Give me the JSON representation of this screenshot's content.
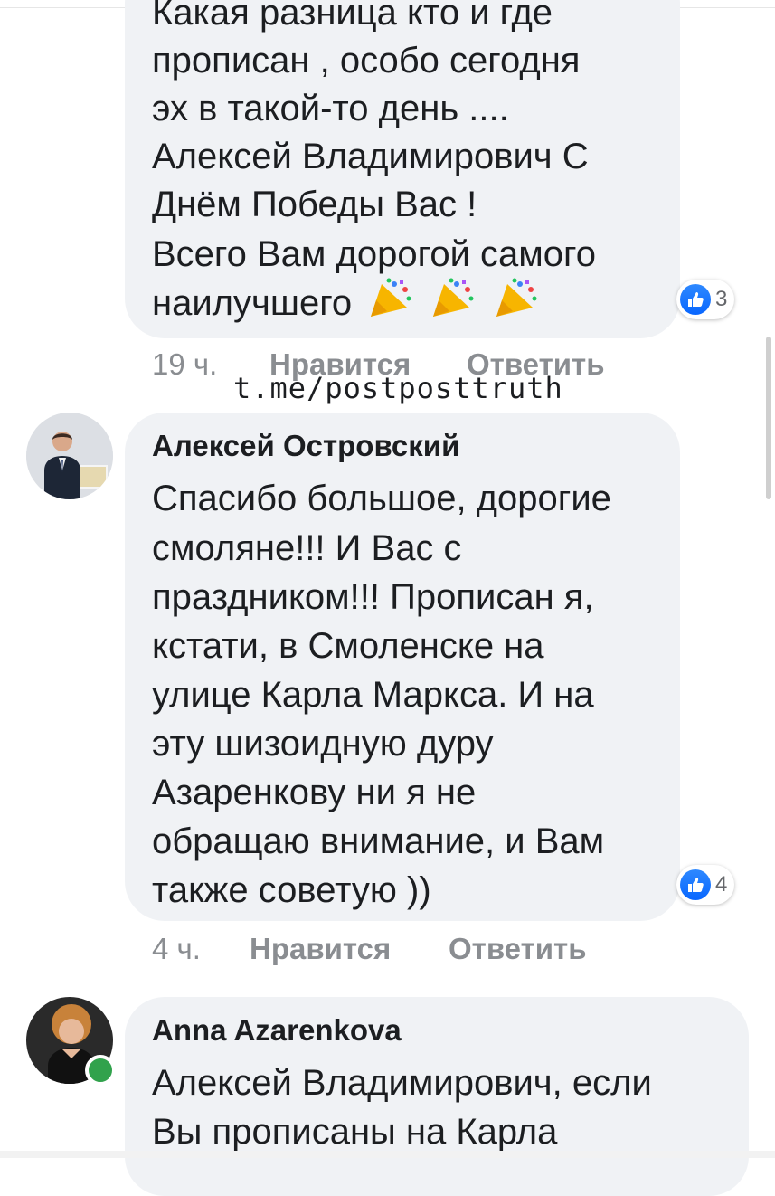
{
  "comment1": {
    "lines": [
      "Какая разница кто и где",
      "прописан , особо сегодня",
      "эх в такой-то день ....",
      "Алексей Владимирович С",
      "Днём Победы Вас !",
      "Всего Вам дорогой самого",
      "наилучшего"
    ],
    "emoji": [
      "party-popper-icon",
      "party-popper-icon",
      "party-popper-icon"
    ],
    "reaction_count": "3",
    "time": "19 ч.",
    "like_label": "Нравится",
    "reply_label": "Ответить"
  },
  "watermark": "t.me/postposttruth",
  "comment2": {
    "author": "Алексей Островский",
    "lines": [
      "Спасибо большое, дорогие",
      "смоляне!!! И Вас с",
      "праздником!!! Прописан я,",
      "кстати, в Смоленске на",
      "улице Карла Маркса. И на",
      "эту шизоидную дуру",
      "Азаренкову ни я не",
      "обращаю внимание, и Вам",
      "также советую ))"
    ],
    "reaction_count": "4",
    "time": "4 ч.",
    "like_label": "Нравится",
    "reply_label": "Ответить"
  },
  "comment3": {
    "author": "Anna Azarenkova",
    "lines": [
      "Алексей Владимирович, если",
      "Вы прописаны на Карла"
    ]
  },
  "colors": {
    "bubble": "#f0f2f5",
    "like_blue": "#0866ff",
    "online": "#31a24c",
    "meta": "#8a8d91"
  }
}
